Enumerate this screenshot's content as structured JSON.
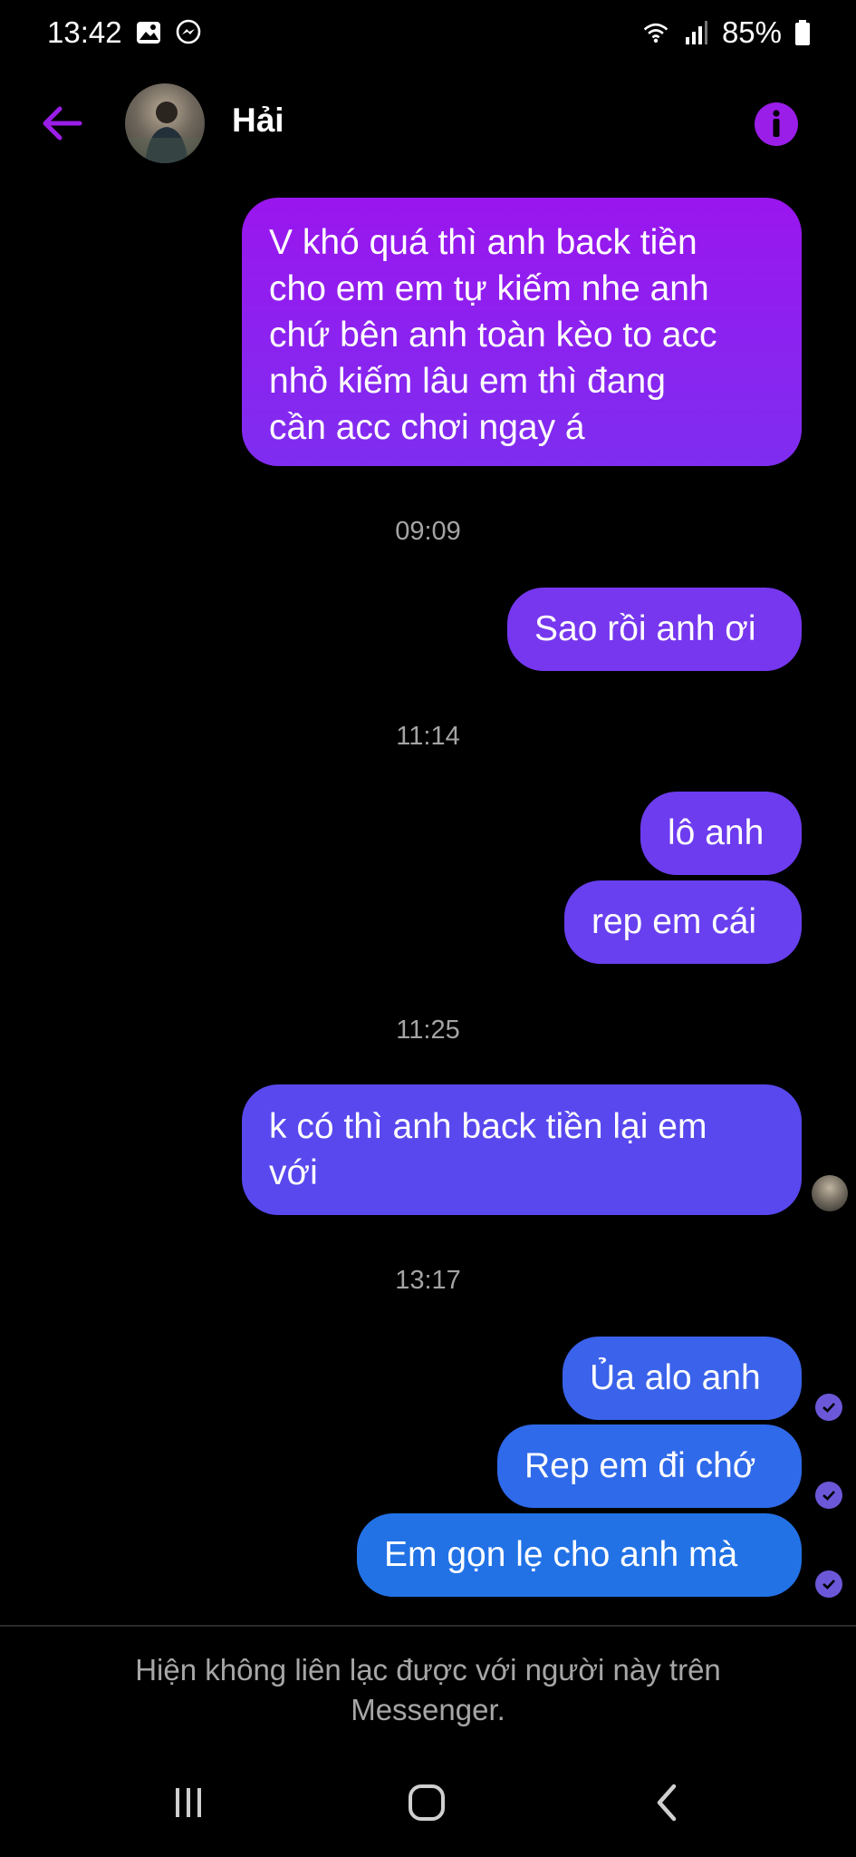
{
  "status_bar": {
    "time": "13:42",
    "battery": "85%",
    "icons": [
      "gallery-icon",
      "messenger-icon",
      "wifi-icon",
      "signal-icon",
      "battery-icon"
    ]
  },
  "header": {
    "contact_name": "Hải",
    "back_icon": "arrow-left-icon",
    "info_icon": "info-icon"
  },
  "messages": [
    {
      "lines": [
        "V khó quá thì anh back tiền",
        "cho em em tự kiếm nhe anh",
        "chứ bên anh toàn kèo to acc",
        "nhỏ kiếm lâu em thì đang",
        "cần acc chơi ngay á"
      ]
    },
    {
      "timestamp": "09:09",
      "lines": [
        "Sao rồi anh ơi"
      ]
    },
    {
      "timestamp": "11:14",
      "lines": [
        "lô anh"
      ]
    },
    {
      "lines": [
        "rep em cái"
      ]
    },
    {
      "timestamp": "11:25",
      "lines": [
        "k có thì anh back tiền lại em",
        "với"
      ]
    },
    {
      "timestamp": "13:17",
      "lines": [
        "Ủa alo anh"
      ]
    },
    {
      "lines": [
        "Rep em đi chớ"
      ]
    },
    {
      "lines": [
        "Em gọn lẹ cho anh mà"
      ]
    }
  ],
  "footer": {
    "unavailable_text": "Hiện không liên lạc được với người này trên Messenger."
  },
  "nav_bar": {
    "icons": [
      "recent-apps-icon",
      "home-icon",
      "back-nav-icon"
    ]
  },
  "colors": {
    "accent": "#9b1ee8",
    "bubble_purple_top": "#9a16ee",
    "bubble_purple_bottom": "#7a2ff0",
    "bubble_indigo": "#5b45ee",
    "bubble_blue": "#2d6de8",
    "background": "#000000"
  }
}
